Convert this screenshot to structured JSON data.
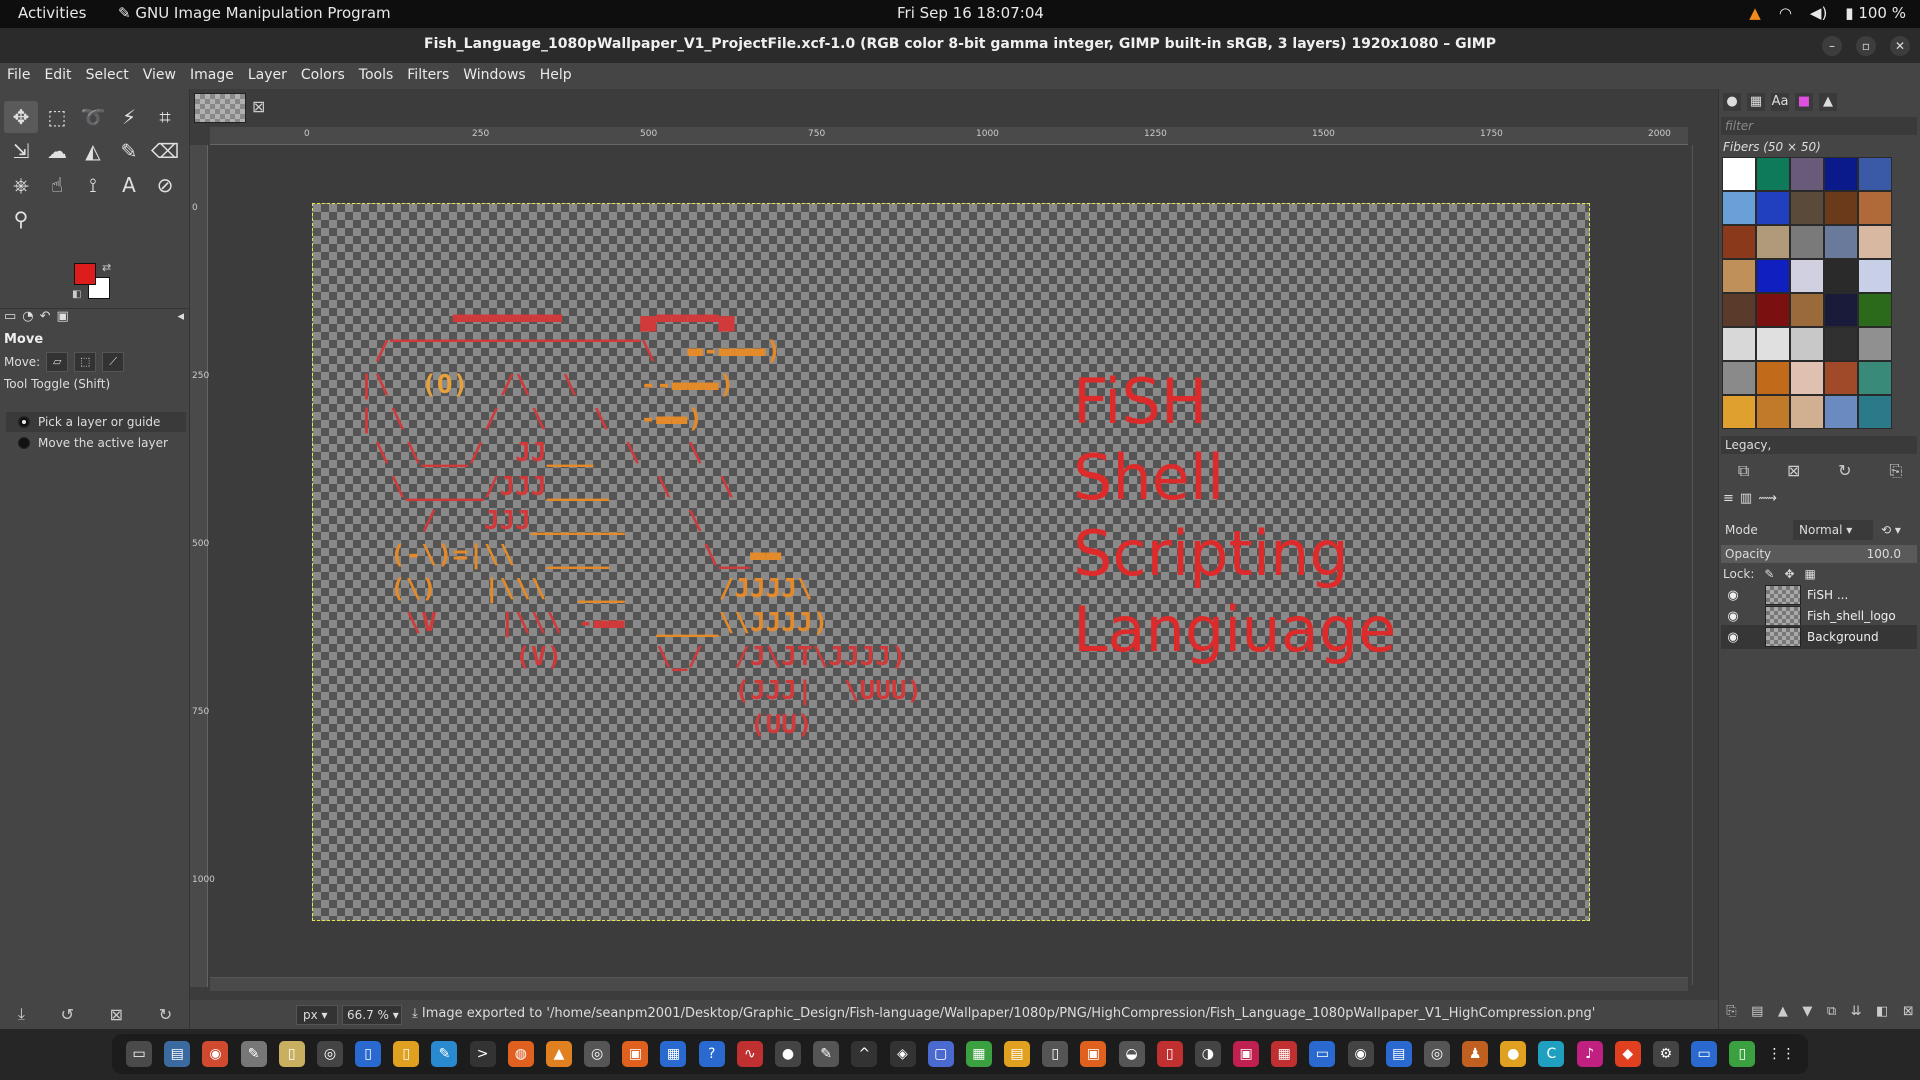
{
  "topbar": {
    "activities": "Activities",
    "app_name": "GNU Image Manipulation Program",
    "clock": "Fri Sep 16  18:07:04",
    "battery": "100 %"
  },
  "window": {
    "title": "Fish_Language_1080pWallpaper_V1_ProjectFile.xcf-1.0 (RGB color 8-bit gamma integer, GIMP built-in sRGB, 3 layers) 1920x1080 – GIMP"
  },
  "menubar": [
    "File",
    "Edit",
    "Select",
    "View",
    "Image",
    "Layer",
    "Colors",
    "Tools",
    "Filters",
    "Windows",
    "Help"
  ],
  "tool_options": {
    "header": "Move",
    "move_label": "Move:",
    "toggle_label": "Tool Toggle  (Shift)",
    "options": [
      "Pick a layer or guide",
      "Move the active layer"
    ],
    "colors": {
      "foreground": "#dd1c1c",
      "background": "#ffffff"
    }
  },
  "rulers": {
    "h_ticks": [
      "0",
      "250",
      "500",
      "750",
      "1000",
      "1250",
      "1500",
      "1750",
      "2000"
    ],
    "v_ticks": [
      "0",
      "250",
      "500",
      "750",
      "1000"
    ]
  },
  "canvas_text": {
    "lines": [
      "FiSH",
      "Shell",
      "Scripting",
      "Langiuage"
    ],
    "color": "#dd2b2b"
  },
  "statusbar": {
    "unit": "px",
    "zoom": "66.7 %",
    "message": "Image exported to '/home/seanpm2001/Desktop/Graphic_Design/Fish-language/Wallpaper/1080p/PNG/HighCompression/Fish_Language_1080pWallpaper_V1_HighCompression.png'"
  },
  "patterns": {
    "filter_placeholder": "filter",
    "title": "Fibers (50 × 50)",
    "tag": "Legacy,"
  },
  "layers": {
    "mode_label": "Mode",
    "mode_value": "Normal",
    "opacity_label": "Opacity",
    "opacity_value": "100.0",
    "lock_label": "Lock:",
    "items": [
      {
        "name": "FiSH ..."
      },
      {
        "name": "Fish_shell_logo"
      },
      {
        "name": "Background"
      }
    ]
  }
}
